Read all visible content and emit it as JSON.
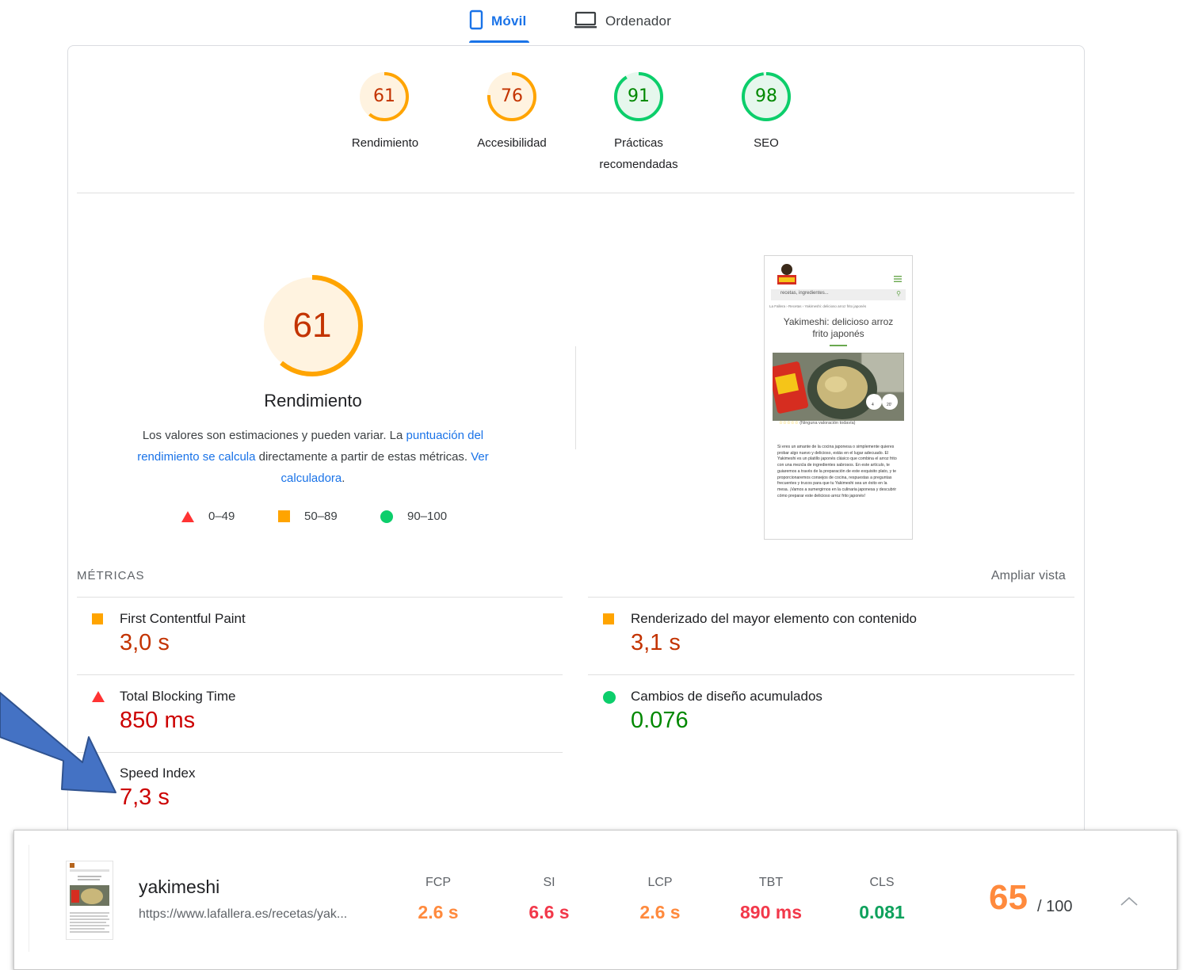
{
  "tabs": [
    {
      "label": "Móvil",
      "icon": "phone-icon",
      "active": true
    },
    {
      "label": "Ordenador",
      "icon": "laptop-icon",
      "active": false
    }
  ],
  "categories": [
    {
      "score": "61",
      "label": "Rendimiento",
      "color": "#ffa400",
      "fill": "#fff3e0",
      "text_color": "#c33300",
      "fraction": 0.61
    },
    {
      "score": "76",
      "label": "Accesibilidad",
      "color": "#ffa400",
      "fill": "#fff3e0",
      "text_color": "#c33300",
      "fraction": 0.76
    },
    {
      "score": "91",
      "label_line1": "Prácticas",
      "label_line2": "recomendadas",
      "color": "#0cce6b",
      "fill": "#e6f7ed",
      "text_color": "#008800",
      "fraction": 0.91
    },
    {
      "score": "98",
      "label": "SEO",
      "color": "#0cce6b",
      "fill": "#e6f7ed",
      "text_color": "#008800",
      "fraction": 0.98
    }
  ],
  "performance": {
    "score": "61",
    "fraction": 0.61,
    "title": "Rendimiento",
    "desc_part1": "Los valores son estimaciones y pueden variar. La ",
    "desc_link1": "puntuación del rendimiento se calcula",
    "desc_part2": " directamente a partir de estas métricas. ",
    "desc_link2": "Ver calculadora",
    "desc_part3": "."
  },
  "legend": [
    {
      "range": "0–49",
      "shape": "triangle",
      "color": "#ff3333"
    },
    {
      "range": "50–89",
      "shape": "square",
      "color": "#ffa400"
    },
    {
      "range": "90–100",
      "shape": "circle",
      "color": "#0cce6b"
    }
  ],
  "thumbnail": {
    "search_placeholder": "recetas, ingredientes...",
    "breadcrumb": "La Fallera  ›  Recetas  ›  Yakimeshi: delicioso arroz frito japonés",
    "title": "Yakimeshi: delicioso arroz frito japonés",
    "rating_text": "(Ninguna valoración todavía)",
    "body": "Si eres un amante de la cocina japonesa o simplemente quieres probar algo nuevo y delicioso, estás en el lugar adecuado. El Yakimeshi es un platillo japonés clásico que combina el arroz frito con una mezcla de ingredientes sabrosos. En este artículo, te guiaremos a través de la preparación de este exquisito plato, y te proporcionaremos consejos de cocina, respuestas a preguntas frecuentes y trucos para que tu Yakimeshi sea un éxito en la mesa. ¡Vamos a sumergirnos en la culinaria japonesa y descubrir cómo preparar este delicioso arroz frito japonés!",
    "badge_servings": "4",
    "badge_time": "20'"
  },
  "metrics": {
    "header": "MÉTRICAS",
    "expand_label": "Ampliar vista",
    "items": [
      {
        "name": "First Contentful Paint",
        "value": "3,0 s",
        "indicator": "square"
      },
      {
        "name": "Renderizado del mayor elemento con contenido",
        "value": "3,1 s",
        "indicator": "square"
      },
      {
        "name": "Total Blocking Time",
        "value": "850 ms",
        "indicator": "triangle"
      },
      {
        "name": "Cambios de diseño acumulados",
        "value": "0.076",
        "indicator": "circle"
      },
      {
        "name": "Speed Index",
        "value": "7,3 s",
        "indicator": "none"
      }
    ]
  },
  "summary": {
    "name": "yakimeshi",
    "url": "https://www.lafallera.es/recetas/yak...",
    "kpis": [
      {
        "label": "FCP",
        "value": "2.6 s",
        "color": "#ff8a3d"
      },
      {
        "label": "SI",
        "value": "6.6 s",
        "color": "#f2384a"
      },
      {
        "label": "LCP",
        "value": "2.6 s",
        "color": "#ff8a3d"
      },
      {
        "label": "TBT",
        "value": "890 ms",
        "color": "#f2384a"
      },
      {
        "label": "CLS",
        "value": "0.081",
        "color": "#0ea15c"
      }
    ],
    "score": "65",
    "score_suffix": "/ 100"
  }
}
